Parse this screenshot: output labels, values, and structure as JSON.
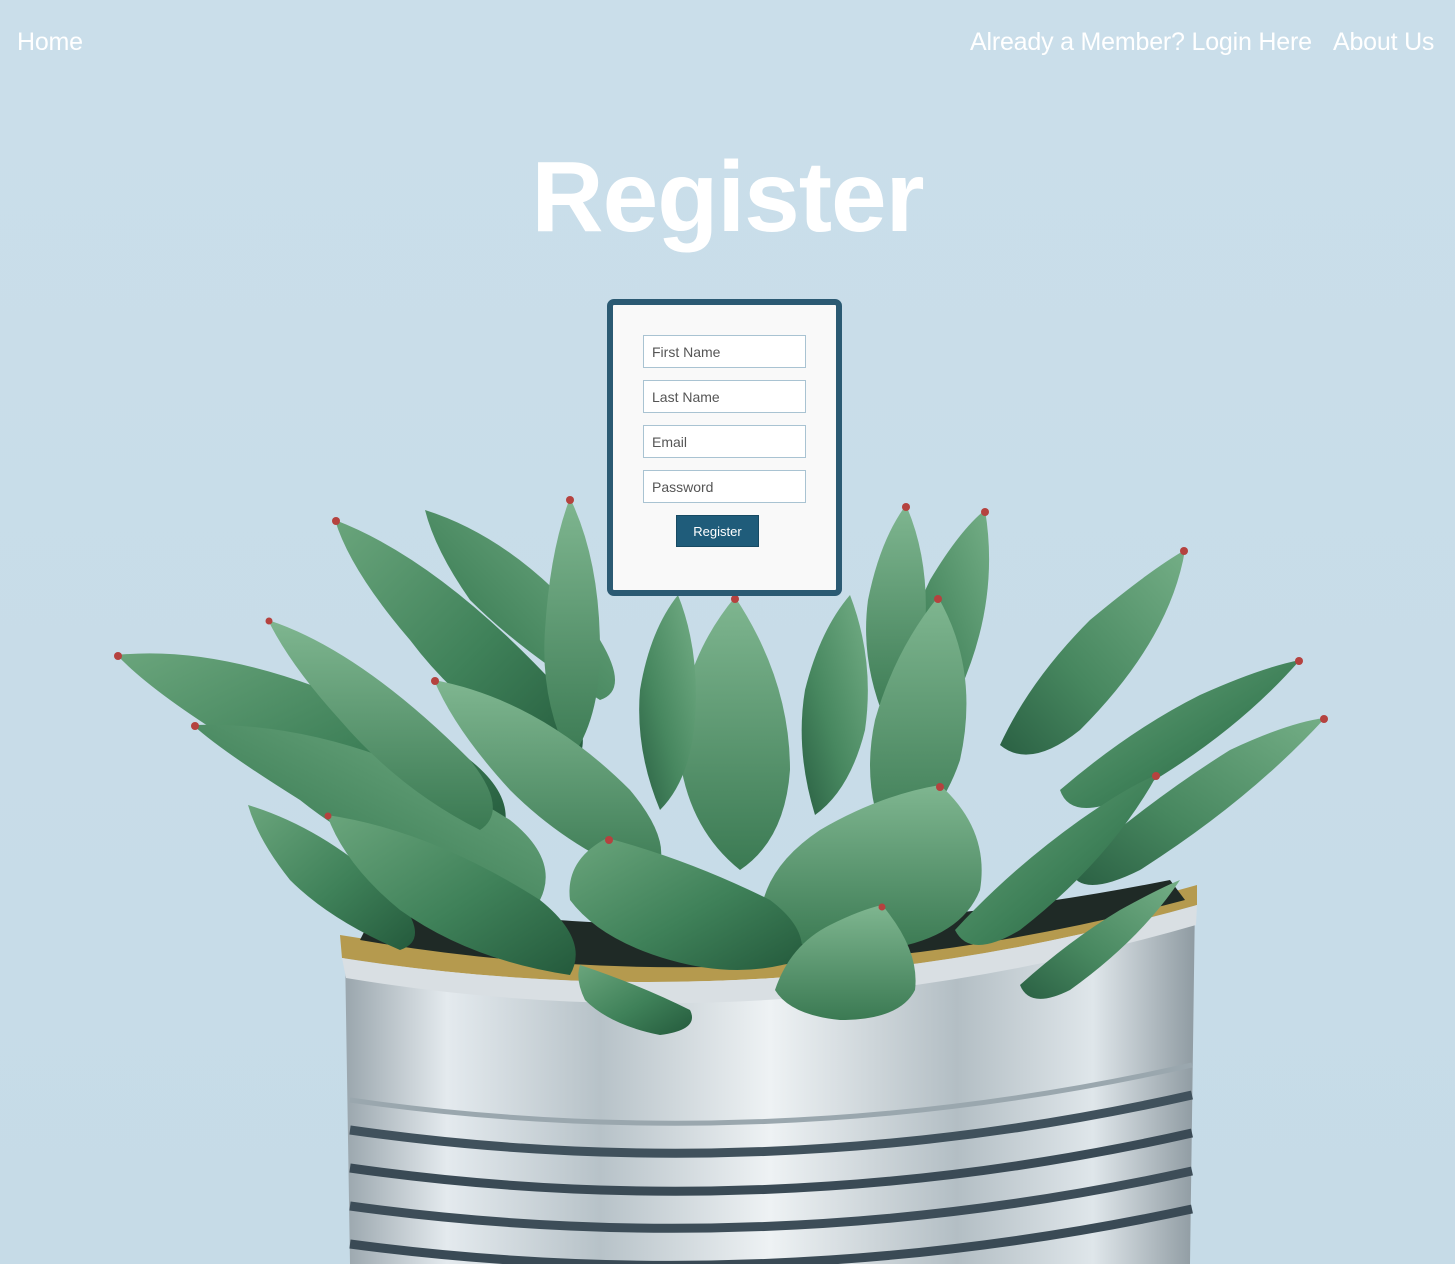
{
  "nav": {
    "home": "Home",
    "login": "Already a Member? Login Here",
    "about": "About Us"
  },
  "page_title": "Register",
  "form": {
    "first_name_placeholder": "First Name",
    "last_name_placeholder": "Last Name",
    "email_placeholder": "Email",
    "password_placeholder": "Password",
    "submit_label": "Register"
  },
  "colors": {
    "background": "#cddfea",
    "card_border": "#2b5a73",
    "button": "#1f5c7a",
    "text_light": "#ffffff"
  }
}
